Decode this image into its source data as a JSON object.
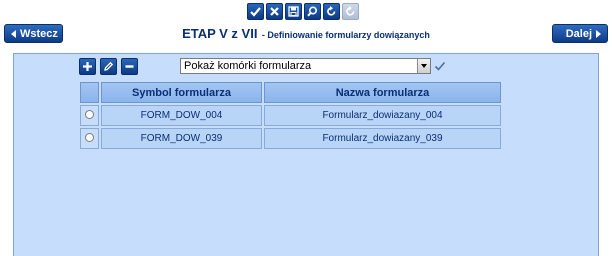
{
  "toolbar": {
    "buttons": [
      {
        "icon": "check-icon",
        "enabled": true
      },
      {
        "icon": "close-icon",
        "enabled": true
      },
      {
        "icon": "save-icon",
        "enabled": true
      },
      {
        "icon": "search-icon",
        "enabled": true
      },
      {
        "icon": "undo-icon",
        "enabled": true
      },
      {
        "icon": "refresh-icon",
        "enabled": false
      }
    ]
  },
  "nav": {
    "back_label": "Wstecz",
    "next_label": "Dalej"
  },
  "header": {
    "title": "ETAP V z VII",
    "subtitle": "- Definiowanie formularzy dowiązanych"
  },
  "actions": {
    "add_icon": "plus-icon",
    "edit_icon": "pencil-icon",
    "remove_icon": "minus-icon"
  },
  "filter": {
    "selected": "Pokaż komórki formularza",
    "confirm_icon": "check-icon"
  },
  "grid": {
    "columns": [
      "Symbol formularza",
      "Nazwa formularza"
    ],
    "rows": [
      {
        "symbol": "FORM_DOW_004",
        "name": "Formularz_dowiazany_004"
      },
      {
        "symbol": "FORM_DOW_039",
        "name": "Formularz_dowiazany_039"
      }
    ]
  },
  "colors": {
    "accent": "#0d3a85",
    "panel": "#c6defb",
    "title_text": "#0b2f74"
  }
}
